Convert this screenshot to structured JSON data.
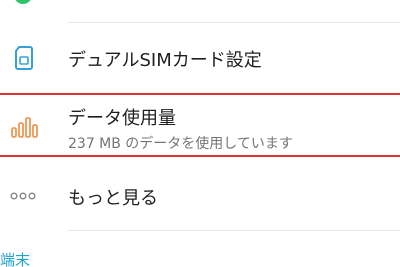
{
  "settings": {
    "items": [
      {
        "id": "dual-sim",
        "title": "デュアルSIMカード設定",
        "icon": "sim-card-icon",
        "icon_color": "#3aa0d8"
      },
      {
        "id": "data-usage",
        "title": "データ使用量",
        "subtitle": "237 MB のデータを使用しています",
        "icon": "bar-chart-icon",
        "icon_color": "#f08a3c",
        "highlighted": true,
        "highlight_color": "#e0303a"
      },
      {
        "id": "more",
        "title": "もっと見る",
        "icon": "more-dots-icon",
        "icon_color": "#8a8a8a"
      }
    ],
    "next_section_partial": "端末"
  },
  "colors": {
    "top_partial_indicator": "#2ec26a",
    "section_header": "#1fa3d4"
  }
}
